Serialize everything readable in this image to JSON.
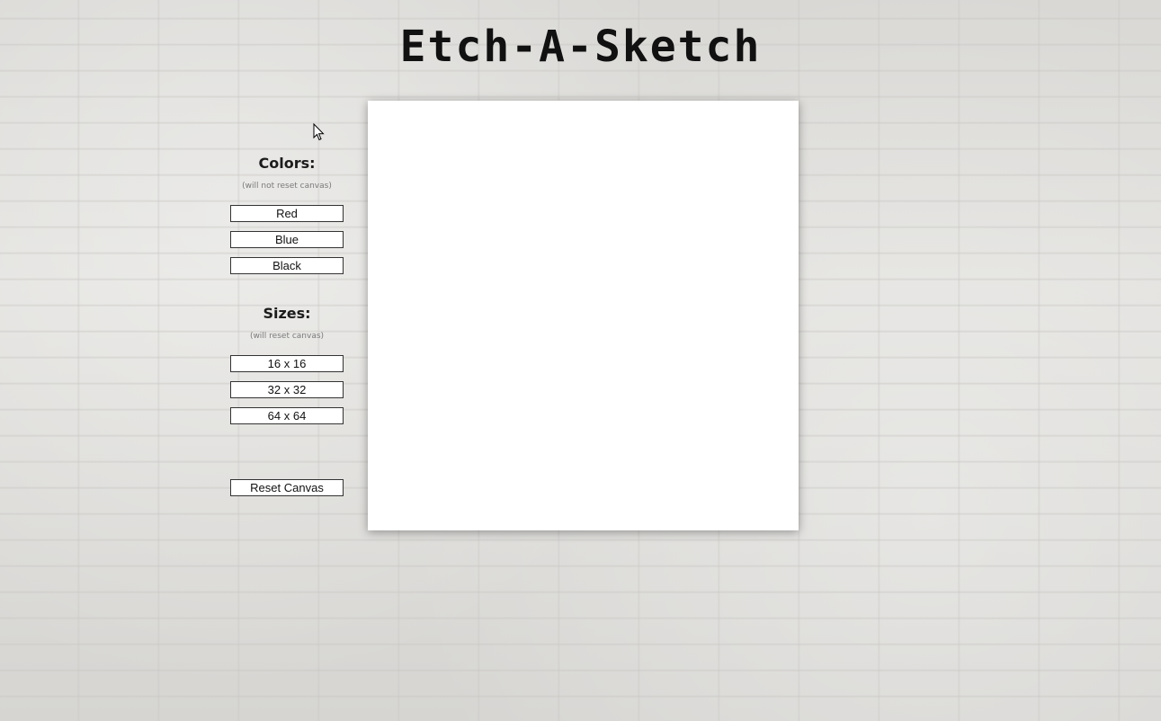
{
  "title": "Etch-A-Sketch",
  "colors": {
    "heading": "Colors:",
    "note": "(will not reset canvas)",
    "buttons": [
      "Red",
      "Blue",
      "Black"
    ]
  },
  "sizes": {
    "heading": "Sizes:",
    "note": "(will reset canvas)",
    "buttons": [
      "16 x 16",
      "32 x 32",
      "64 x 64"
    ]
  },
  "reset_label": "Reset Canvas",
  "theme": {
    "canvas_color": "#ffffff",
    "button_border": "#333333"
  }
}
